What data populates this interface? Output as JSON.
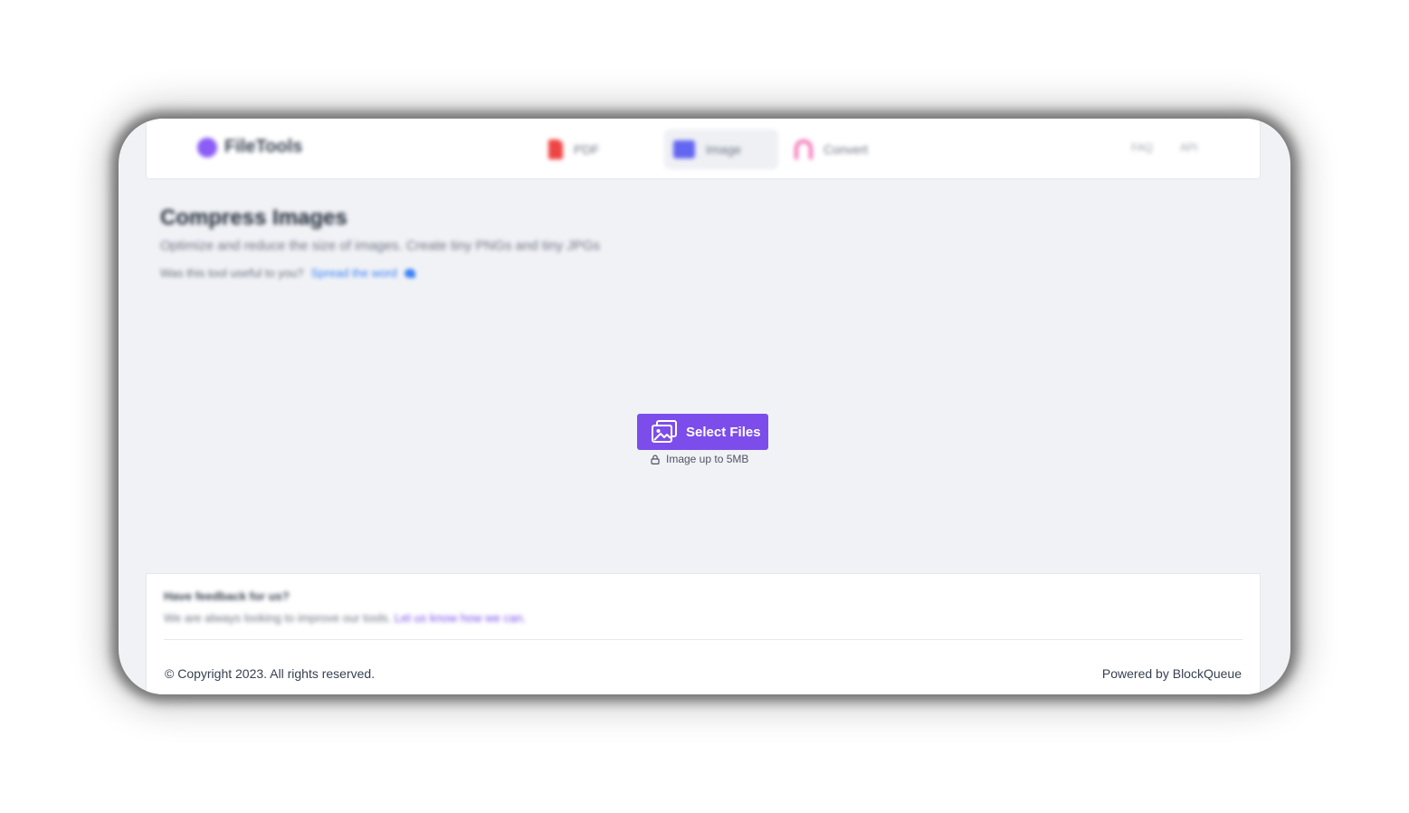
{
  "nav": {
    "brand": "FileTools",
    "items": [
      {
        "label": "PDF",
        "icon": "pdf-file-icon",
        "color": "#ef4444"
      },
      {
        "label": "Image",
        "icon": "image-icon",
        "color": "#6366f1",
        "active": true
      },
      {
        "label": "Convert",
        "icon": "convert-icon",
        "color": "#f472b6"
      }
    ],
    "faq": "FAQ",
    "api": "API"
  },
  "hero": {
    "title": "Compress Images",
    "subtitle": "Optimize and reduce the size of images. Create tiny PNGs and tiny JPGs",
    "share_question": "Was this tool useful to you?",
    "share_link": "Spread the word"
  },
  "upload": {
    "button_label": "Select Files",
    "limit_text": "Image up to 5MB",
    "accent": "#7c4dea"
  },
  "footer": {
    "feedback_title": "Have feedback for us?",
    "feedback_text": "We are always looking to improve our tools.",
    "feedback_link": "Let us know how we can.",
    "copyright": "© Copyright 2023. All rights reserved.",
    "powered_by": "Powered by BlockQueue"
  }
}
